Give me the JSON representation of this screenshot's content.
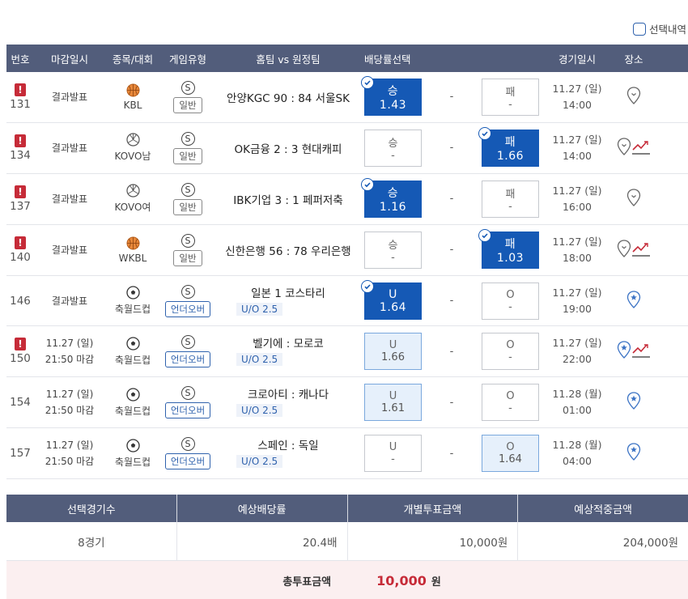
{
  "topbar": {
    "selection_label": "선택내역"
  },
  "columns": {
    "num": "번호",
    "deadline": "마감일시",
    "sport": "종목/대회",
    "type": "게임유형",
    "match": "홈팀 vs 원정팀",
    "bet": "배당률선택",
    "date": "경기일시",
    "place": "장소"
  },
  "colors": {
    "header_bg": "#525d7b",
    "selected": "#1559b5",
    "alert": "#c62b38",
    "total_bg": "#fbeff0"
  },
  "rows": [
    {
      "alert": true,
      "num": "131",
      "dead1": "결과발표",
      "dead2": "",
      "sport_icon": "basketball-icon",
      "league": "KBL",
      "s": "S",
      "gtype": "일반",
      "ou": false,
      "match": "안양KGC 90 : 84 서울SK",
      "uo": "",
      "left": {
        "lbl": "승",
        "val": "1.43",
        "state": "sel"
      },
      "mid": "-",
      "right": {
        "lbl": "패",
        "val": "-",
        "state": ""
      },
      "date1": "11.27 (일)",
      "date2": "14:00",
      "trend": false
    },
    {
      "alert": true,
      "num": "134",
      "dead1": "결과발표",
      "dead2": "",
      "sport_icon": "volleyball-icon",
      "league": "KOVO남",
      "s": "S",
      "gtype": "일반",
      "ou": false,
      "match": "OK금융 2 : 3 현대캐피",
      "uo": "",
      "left": {
        "lbl": "승",
        "val": "-",
        "state": ""
      },
      "mid": "-",
      "right": {
        "lbl": "패",
        "val": "1.66",
        "state": "sel"
      },
      "date1": "11.27 (일)",
      "date2": "14:00",
      "trend": true
    },
    {
      "alert": true,
      "num": "137",
      "dead1": "결과발표",
      "dead2": "",
      "sport_icon": "volleyball-icon",
      "league": "KOVO여",
      "s": "S",
      "gtype": "일반",
      "ou": false,
      "match": "IBK기업 3 : 1 페퍼저축",
      "uo": "",
      "left": {
        "lbl": "승",
        "val": "1.16",
        "state": "sel"
      },
      "mid": "-",
      "right": {
        "lbl": "패",
        "val": "-",
        "state": ""
      },
      "date1": "11.27 (일)",
      "date2": "16:00",
      "trend": false
    },
    {
      "alert": true,
      "num": "140",
      "dead1": "결과발표",
      "dead2": "",
      "sport_icon": "basketball-icon",
      "league": "WKBL",
      "s": "S",
      "gtype": "일반",
      "ou": false,
      "match": "신한은행 56 : 78 우리은행",
      "uo": "",
      "left": {
        "lbl": "승",
        "val": "-",
        "state": ""
      },
      "mid": "-",
      "right": {
        "lbl": "패",
        "val": "1.03",
        "state": "sel"
      },
      "date1": "11.27 (일)",
      "date2": "18:00",
      "trend": true
    },
    {
      "alert": false,
      "num": "146",
      "dead1": "결과발표",
      "dead2": "",
      "sport_icon": "soccer-icon",
      "league": "축월드컵",
      "s": "S",
      "gtype": "언더오버",
      "ou": true,
      "match": "일본    1    코스타리",
      "uo": "U/O 2.5",
      "left": {
        "lbl": "U",
        "val": "1.64",
        "state": "sel"
      },
      "mid": "-",
      "right": {
        "lbl": "O",
        "val": "-",
        "state": ""
      },
      "date1": "11.27 (일)",
      "date2": "19:00",
      "trend": false
    },
    {
      "alert": true,
      "num": "150",
      "dead1": "11.27 (일)",
      "dead2": "21:50 마감",
      "sport_icon": "soccer-icon",
      "league": "축월드컵",
      "s": "S",
      "gtype": "언더오버",
      "ou": true,
      "match": "벨기에 : 모로코",
      "uo": "U/O 2.5",
      "left": {
        "lbl": "U",
        "val": "1.66",
        "state": "light"
      },
      "mid": "-",
      "right": {
        "lbl": "O",
        "val": "-",
        "state": ""
      },
      "date1": "11.27 (일)",
      "date2": "22:00",
      "trend": true
    },
    {
      "alert": false,
      "num": "154",
      "dead1": "11.27 (일)",
      "dead2": "21:50 마감",
      "sport_icon": "soccer-icon",
      "league": "축월드컵",
      "s": "S",
      "gtype": "언더오버",
      "ou": true,
      "match": "크로아티 : 캐나다",
      "uo": "U/O 2.5",
      "left": {
        "lbl": "U",
        "val": "1.61",
        "state": "light"
      },
      "mid": "-",
      "right": {
        "lbl": "O",
        "val": "-",
        "state": ""
      },
      "date1": "11.28 (월)",
      "date2": "01:00",
      "trend": false
    },
    {
      "alert": false,
      "num": "157",
      "dead1": "11.27 (일)",
      "dead2": "21:50 마감",
      "sport_icon": "soccer-icon",
      "league": "축월드컵",
      "s": "S",
      "gtype": "언더오버",
      "ou": true,
      "match": "스페인 : 독일",
      "uo": "U/O 2.5",
      "left": {
        "lbl": "U",
        "val": "-",
        "state": ""
      },
      "mid": "-",
      "right": {
        "lbl": "O",
        "val": "1.64",
        "state": "light"
      },
      "date1": "11.28 (월)",
      "date2": "04:00",
      "trend": false
    }
  ],
  "summary": {
    "h1": "선택경기수",
    "h2": "예상배당률",
    "h3": "개별투표금액",
    "h4": "예상적중금액",
    "v1": "8경기",
    "v2": "20.4배",
    "v3": "10,000원",
    "v4": "204,000원",
    "total_label": "총투표금액",
    "total_amount": "10,000",
    "total_unit": "원"
  }
}
